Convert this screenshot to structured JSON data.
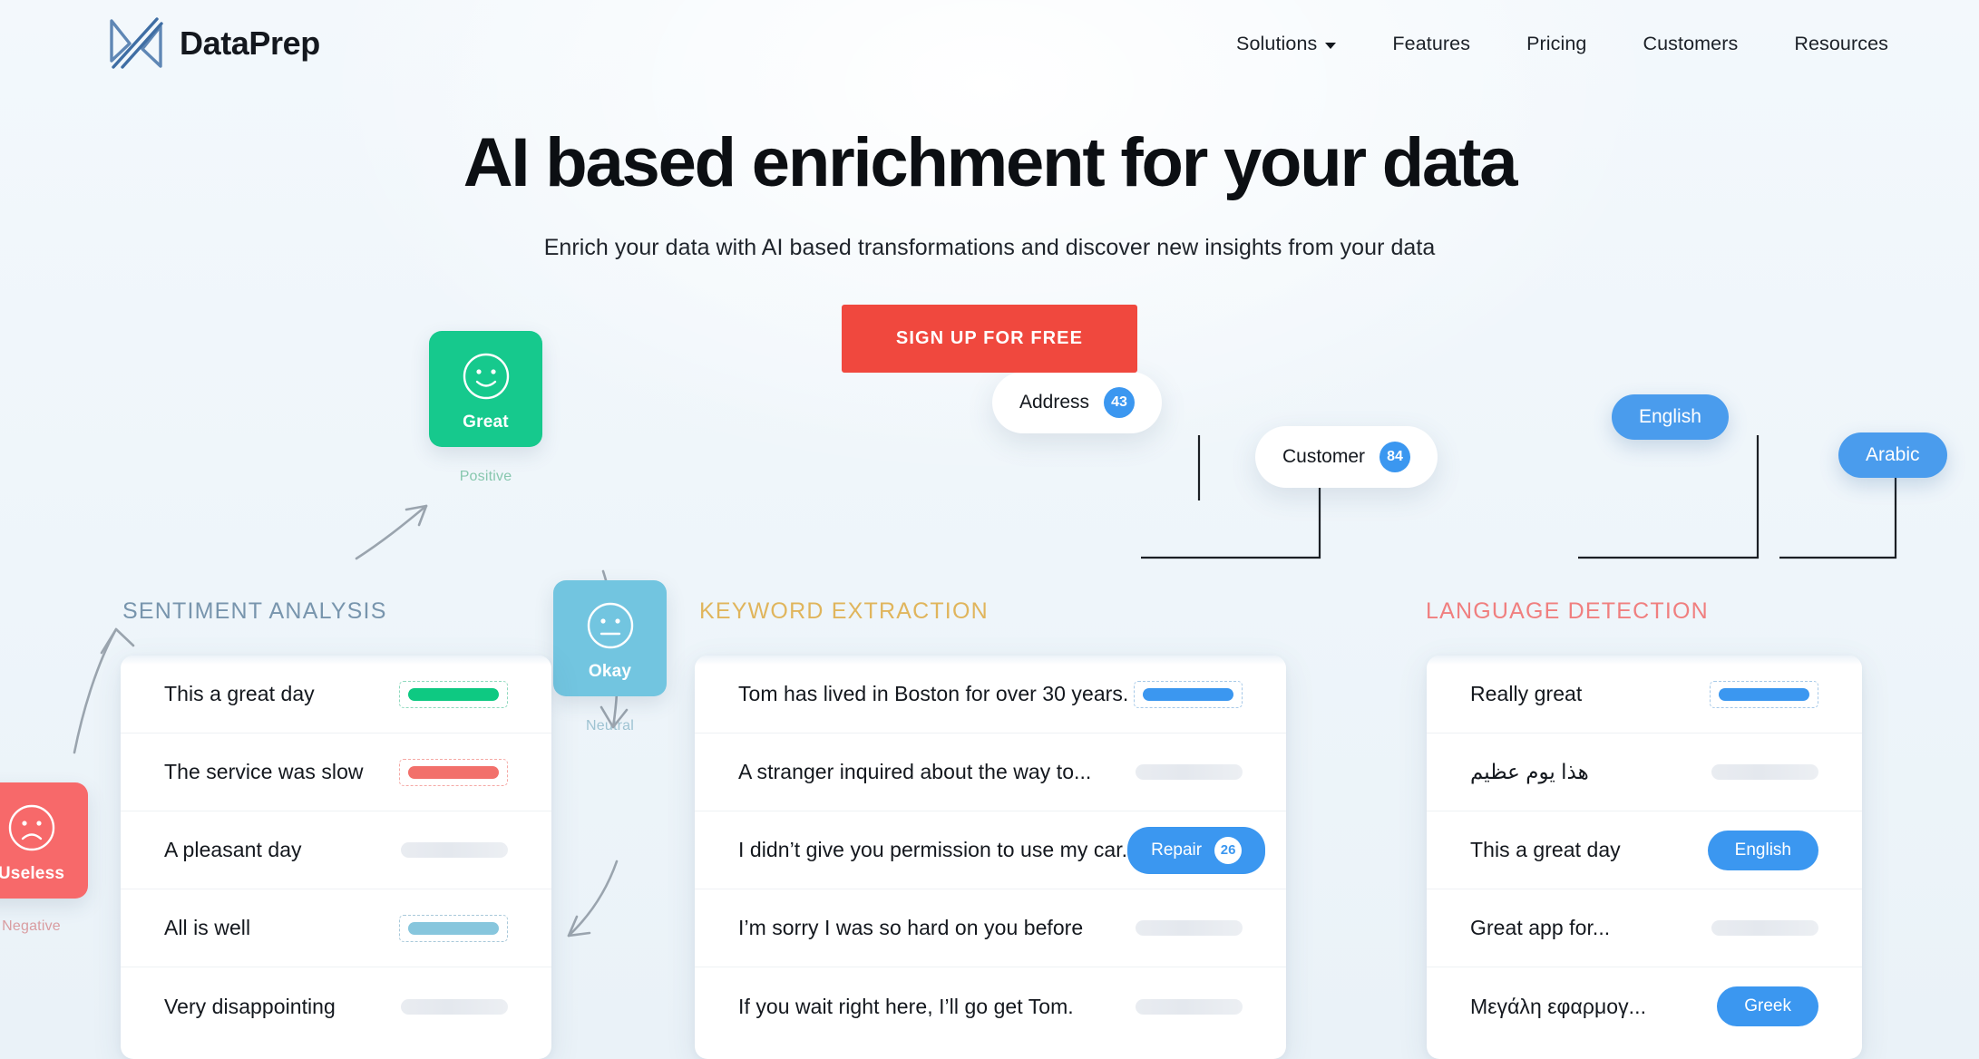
{
  "brand": {
    "name": "DataPrep",
    "logo_icon": "dataprep-x-logo"
  },
  "nav": {
    "items": [
      {
        "label": "Solutions",
        "has_dropdown": true
      },
      {
        "label": "Features",
        "has_dropdown": false
      },
      {
        "label": "Pricing",
        "has_dropdown": false
      },
      {
        "label": "Customers",
        "has_dropdown": false
      },
      {
        "label": "Resources",
        "has_dropdown": false
      }
    ]
  },
  "hero": {
    "title": "AI based enrichment for your data",
    "subtitle": "Enrich your data with AI based transformations and discover new insights from your data",
    "cta_label": "SIGN UP FOR FREE",
    "cta_color": "#F0483E"
  },
  "showcase": {
    "sentiment": {
      "label": "SENTIMENT ANALYSIS",
      "label_color": "#7895ad",
      "rows": [
        {
          "text": "This a great day",
          "value_type": "chip-dashed",
          "value_color": "#0EC982"
        },
        {
          "text": "The service was slow",
          "value_type": "chip-dashed",
          "value_color": "#F2706B"
        },
        {
          "text": "A pleasant day",
          "value_type": "bar-gray",
          "value_color": "#E9ECF1"
        },
        {
          "text": "All is well",
          "value_type": "chip-dashed",
          "value_color": "#87C6DD"
        },
        {
          "text": "Very disappointing",
          "value_type": "bar-gray",
          "value_color": "#E9ECF1"
        }
      ],
      "moods": [
        {
          "label": "Great",
          "caption": "Positive",
          "face": "smile-face-icon",
          "color": "#16C98D"
        },
        {
          "label": "Okay",
          "caption": "Neutral",
          "face": "neutral-face-icon",
          "color": "#72C5E0"
        },
        {
          "label": "Useless",
          "caption": "Negative",
          "face": "frown-face-icon",
          "color": "#F7696A"
        }
      ]
    },
    "keyword": {
      "label": "KEYWORD EXTRACTION",
      "label_color": "#e0b55c",
      "rows": [
        {
          "text": "Tom has lived in Boston for over 30 years.",
          "value_type": "chip-dashed",
          "value_color": "#3B97F0"
        },
        {
          "text": "A stranger inquired about the way to...",
          "value_type": "bar-gray",
          "value_color": "#E9ECF1"
        },
        {
          "text": "I didn’t give you permission to use my car.",
          "value_type": "tag-pill",
          "tag_label": "Repair",
          "tag_count": "26"
        },
        {
          "text": "I’m sorry I was so hard on you before",
          "value_type": "bar-gray",
          "value_color": "#E9ECF1"
        },
        {
          "text": "If you wait right here, I’ll go get Tom.",
          "value_type": "bar-gray",
          "value_color": "#E9ECF1"
        }
      ],
      "callouts": [
        {
          "text": "Address",
          "count": "43"
        },
        {
          "text": "Customer",
          "count": "84"
        }
      ]
    },
    "language": {
      "label": "LANGUAGE DETECTION",
      "label_color": "#f07f7f",
      "rows": [
        {
          "text": "Really great",
          "value_type": "chip-dashed",
          "value_color": "#3B97F0"
        },
        {
          "text": "هذا يوم عظيم",
          "value_type": "bar-gray",
          "value_color": "#E9ECF1"
        },
        {
          "text": "This a great day",
          "value_type": "tag-pill",
          "tag_label": "English"
        },
        {
          "text": "Great app for...",
          "value_type": "bar-gray",
          "value_color": "#E9ECF1"
        },
        {
          "text": "Μεγάλη εφαρμογ...",
          "value_type": "tag-pill",
          "tag_label": "Greek"
        }
      ],
      "pills": [
        {
          "label": "English"
        },
        {
          "label": "Arabic"
        }
      ]
    }
  }
}
